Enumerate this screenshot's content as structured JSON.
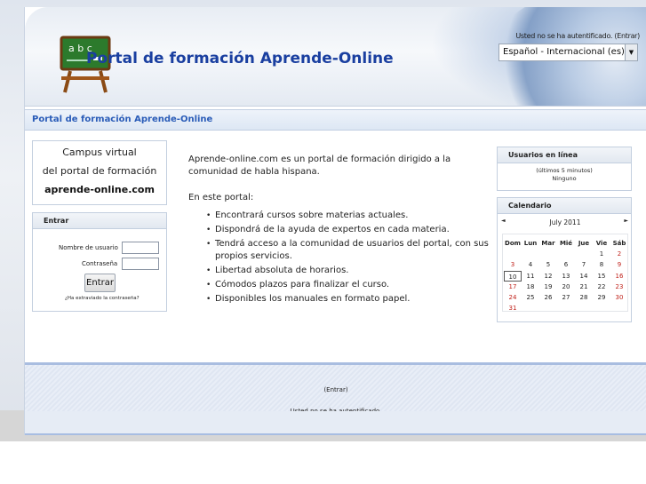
{
  "header": {
    "site_title": "Portal de formación Aprende-Online",
    "login_text": "Usted no se ha autentificado.",
    "login_link": "(Entrar)",
    "language_selected": "Español - Internacional (es)",
    "logo_icon": "chalkboard-icon"
  },
  "navbar": {
    "breadcrumb": "Portal de formación Aprende-Online"
  },
  "left": {
    "campus": {
      "line1": "Campus virtual",
      "line2": "del portal de formación",
      "line3": "aprende-online.com"
    },
    "login_block": {
      "title": "Entrar",
      "username_label": "Nombre de usuario",
      "password_label": "Contraseña",
      "submit_label": "Entrar",
      "forgot_link": "¿Ha extraviado la contraseña?"
    }
  },
  "main": {
    "intro": "Aprende-online.com es un portal de formación dirigido a la comunidad de habla hispana.",
    "list_heading": "En este portal:",
    "items": [
      "Encontrará cursos sobre materias actuales.",
      "Dispondrá de la ayuda de expertos en cada materia.",
      "Tendrá acceso a la comunidad de usuarios del portal, con sus propios servicios.",
      "Libertad absoluta de horarios.",
      "Cómodos plazos para finalizar el curso.",
      "Disponibles los manuales en formato papel."
    ]
  },
  "right": {
    "users": {
      "title": "Usuarios en línea",
      "window": "(últimos 5 minutos)",
      "list": "Ninguno"
    },
    "calendar": {
      "title": "Calendario",
      "month": "July 2011",
      "prev": "◄",
      "next": "►",
      "days": [
        "Dom",
        "Lun",
        "Mar",
        "Mié",
        "Jue",
        "Vie",
        "Sáb"
      ],
      "weeks": [
        [
          "",
          "",
          "",
          "",
          "",
          "1",
          "2"
        ],
        [
          "3",
          "4",
          "5",
          "6",
          "7",
          "8",
          "9"
        ],
        [
          "10",
          "11",
          "12",
          "13",
          "14",
          "15",
          "16"
        ],
        [
          "17",
          "18",
          "19",
          "20",
          "21",
          "22",
          "23"
        ],
        [
          "24",
          "25",
          "26",
          "27",
          "28",
          "29",
          "30"
        ],
        [
          "31",
          "",
          "",
          "",
          "",
          "",
          ""
        ]
      ],
      "today": "10",
      "weekend_color": "#c0221b"
    }
  },
  "footer": {
    "login_text": "Usted no se ha autentificado.",
    "login_link": "(Entrar)"
  },
  "colors": {
    "title_blue": "#1a3fa0",
    "link_blue": "#2a5cb8"
  }
}
